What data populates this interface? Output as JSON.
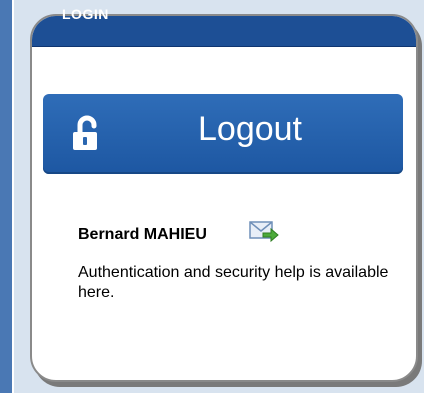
{
  "sidebar": {
    "accent": "#4a78b4"
  },
  "panel": {
    "title": "LOGIN",
    "header_color": "#1d4f95",
    "logout_button": {
      "label": "Logout",
      "icon": "unlocked-padlock-icon",
      "color": "#2f6db8"
    },
    "user": {
      "name": "Bernard MAHIEU",
      "mail_icon": "send-email-icon"
    },
    "help": {
      "line_before_link": "Authentication and security help is available ",
      "link_text": "here",
      "line_after_link": "."
    }
  }
}
